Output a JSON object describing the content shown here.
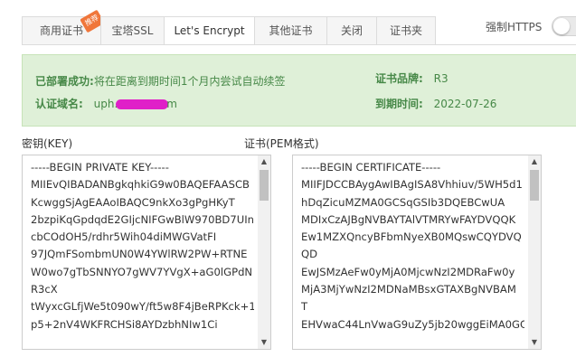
{
  "tabs": [
    {
      "label": "商用证书",
      "badge": "推荐"
    },
    {
      "label": "宝塔SSL"
    },
    {
      "label": "Let's Encrypt",
      "active": true
    },
    {
      "label": "其他证书"
    },
    {
      "label": "关闭"
    },
    {
      "label": "证书夹"
    }
  ],
  "force_https": {
    "label": "强制HTTPS",
    "enabled": false
  },
  "info": {
    "deployed_key": "已部署成功:",
    "deployed_value": "将在距离到期时间1个月内尝试自动续签",
    "brand_key": "证书品牌:",
    "brand_value": "R3",
    "domain_key": "认证域名:",
    "domain_prefix": "uph.",
    "domain_suffix": "m",
    "expiry_key": "到期时间:",
    "expiry_value": "2022-07-26"
  },
  "key_panel": {
    "label": "密钥(KEY)",
    "lines": [
      "-----BEGIN PRIVATE KEY-----",
      "MIIEvQIBADANBgkqhkiG9w0BAQEFAASCB",
      "KcwggSjAgEAAoIBAQC9nkXo3gPgHKyT",
      "2bzpiKqGpdqdE2GIjcNIFGwBlW970BD7UIn",
      "cbCOdOH5/rdhr5Wih04diMWGVatFI",
      "97JQmFSombmUN0W4YWlRW2PW+RTNE",
      "W0wo7gTbSNNYO7gWV7YVgX+aG0lGPdN",
      "R3cX",
      "tWyxcGLfjWe5t090wY/ft5w8F4jBeRPKck+1",
      "p5+2nV4WKFRCHSi8AYDzbhNIw1Ci"
    ]
  },
  "cert_panel": {
    "label": "证书(PEM格式)",
    "lines": [
      "-----BEGIN CERTIFICATE-----",
      "MIIFJDCCBAygAwIBAgISA8Vhhiuv/5WH5d1",
      "hDqZicuMZMA0GCSqGSIb3DQEBCwUA",
      "MDIxCzAJBgNVBAYTAlVTMRYwFAYDVQQK",
      "Ew1MZXQncyBFbmNyeXB0MQswCQYDVQ",
      "QD",
      "EwJSMzAeFw0yMjA0MjcwNzI2MDRaFw0y",
      "MjA3MjYwNzI2MDNaMBsxGTAXBgNVBAM",
      "T",
      "EHVwaC44LnVwaG9uZy5jb20wggEiMA0GC"
    ]
  }
}
